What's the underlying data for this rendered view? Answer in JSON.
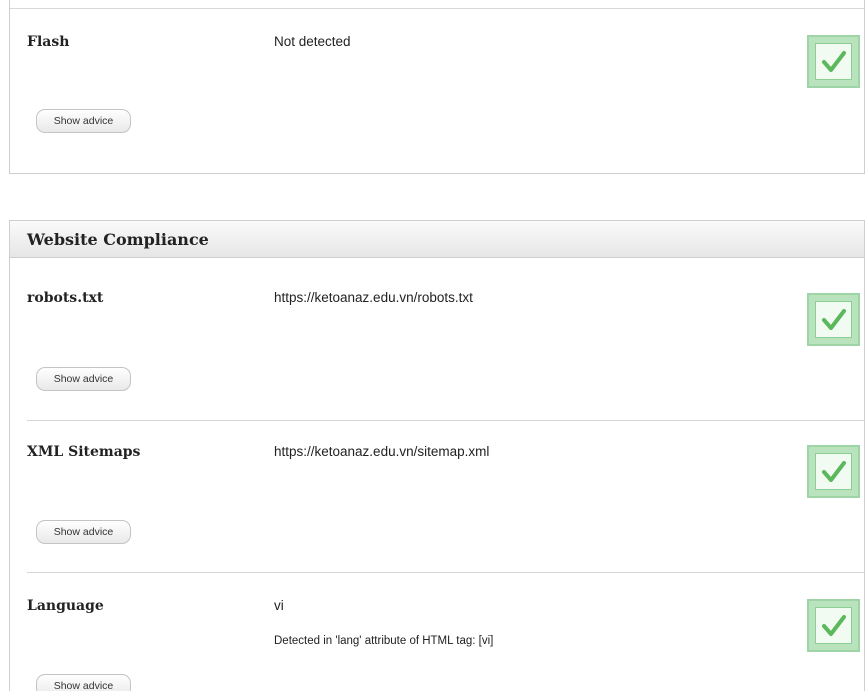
{
  "flash": {
    "label": "Flash",
    "value": "Not detected",
    "status_icon": "checkmark-icon",
    "advice_label": "Show advice"
  },
  "compliance": {
    "title": "Website Compliance",
    "rows": [
      {
        "label": "robots.txt",
        "value": "https://ketoanaz.edu.vn/robots.txt",
        "status_icon": "checkmark-icon",
        "advice_label": "Show advice"
      },
      {
        "label": "XML Sitemaps",
        "value": "https://ketoanaz.edu.vn/sitemap.xml",
        "status_icon": "checkmark-icon",
        "advice_label": "Show advice"
      },
      {
        "label": "Language",
        "value": "vi",
        "note": "Detected in 'lang' attribute of HTML tag: [vi]",
        "status_icon": "checkmark-icon",
        "advice_label": "Show advice"
      }
    ]
  },
  "colors": {
    "check_green": "#5cb85c",
    "check_border": "#9fd4a6",
    "check_fill": "#b9e3bd"
  }
}
